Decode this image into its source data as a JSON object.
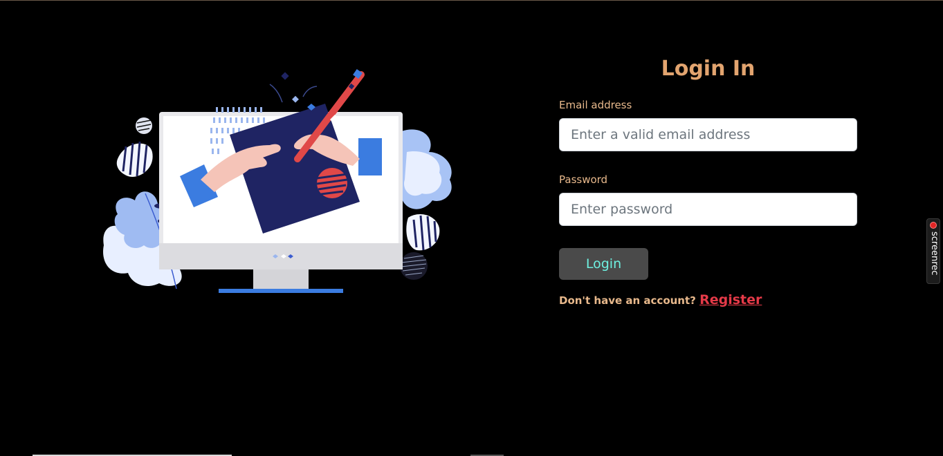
{
  "login_form": {
    "title": "Login In",
    "email_label": "Email address",
    "email_placeholder": "Enter a valid email address",
    "email_value": "",
    "password_label": "Password",
    "password_placeholder": "Enter password",
    "password_value": "",
    "login_button_label": "Login",
    "register_prompt": "Don't have an account?",
    "register_link_label": "Register"
  },
  "illustration": {
    "icon": "designer-monitor-illustration"
  },
  "screen_recorder": {
    "label": "screenrec"
  },
  "colors": {
    "background": "#000000",
    "title": "#e2a46f",
    "label": "#e8b98c",
    "button_bg": "#4a4a4a",
    "button_text": "#6ef0e0",
    "register_link": "#e53a48"
  }
}
